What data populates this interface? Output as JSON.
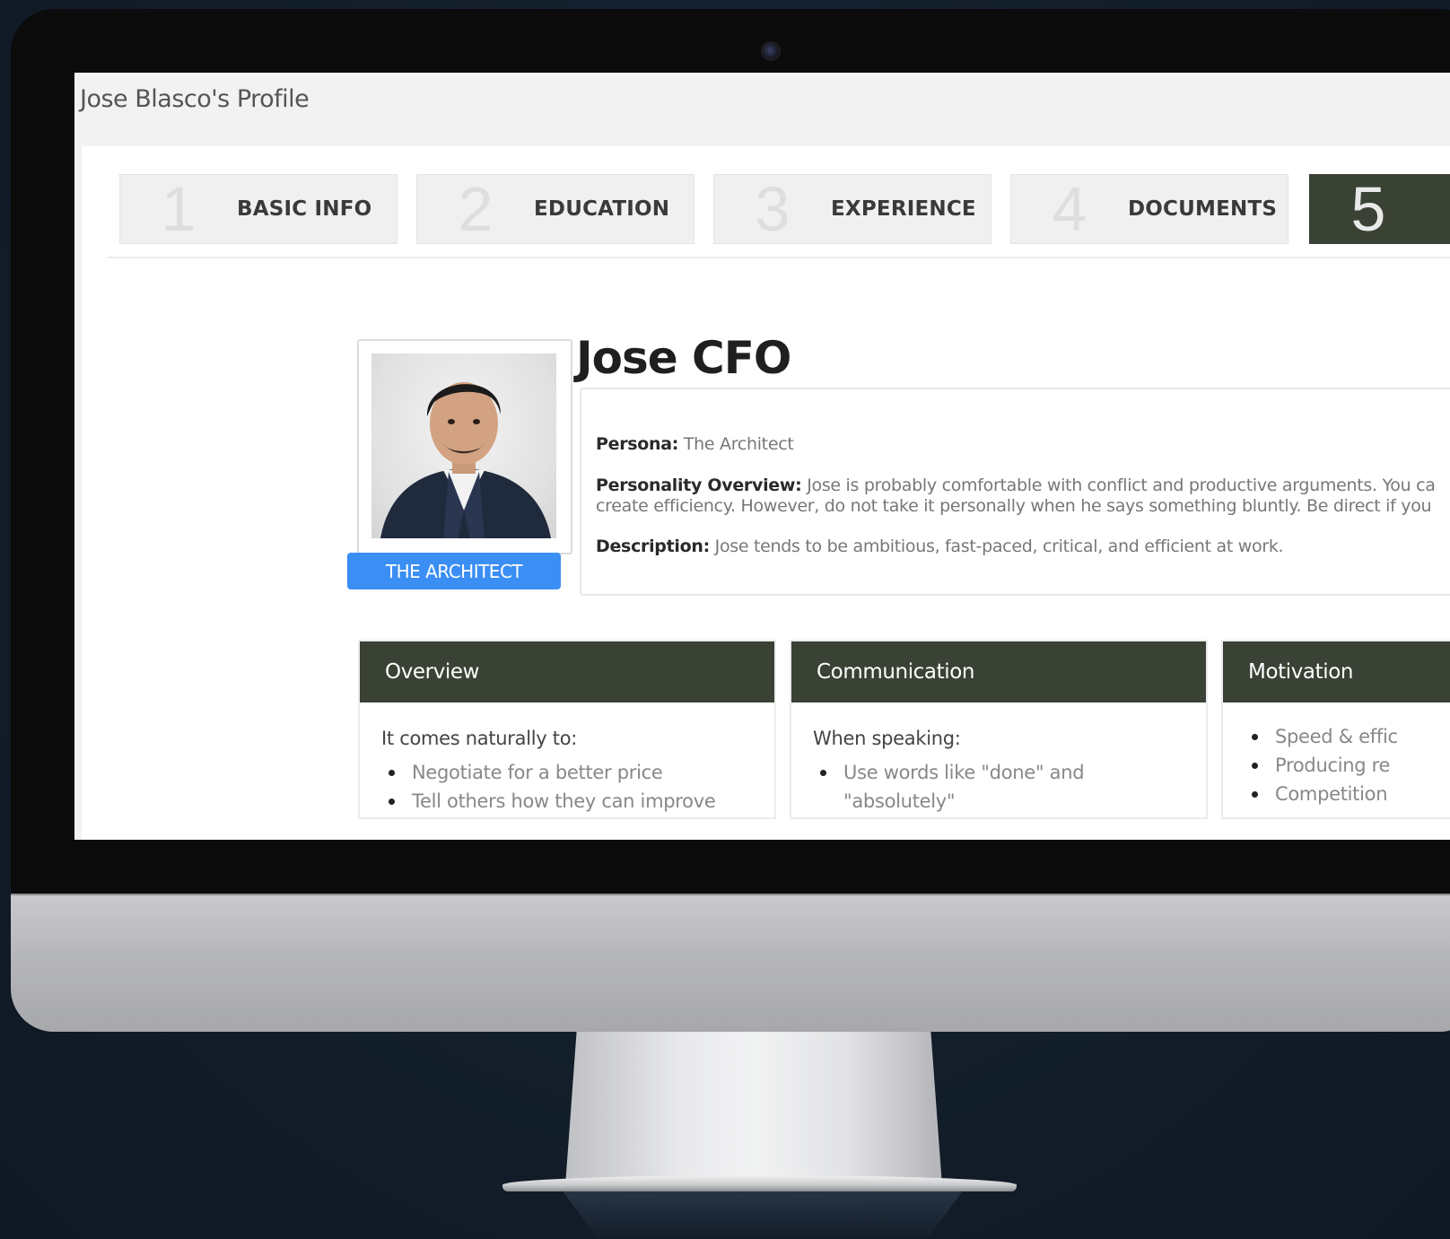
{
  "window": {
    "title": "Jose Blasco's Profile"
  },
  "steps": [
    {
      "number": "1",
      "label": "BASIC INFO",
      "active": false
    },
    {
      "number": "2",
      "label": "EDUCATION",
      "active": false
    },
    {
      "number": "3",
      "label": "EXPERIENCE",
      "active": false
    },
    {
      "number": "4",
      "label": "DOCUMENTS",
      "active": false
    },
    {
      "number": "5",
      "label": "",
      "active": true
    }
  ],
  "profile": {
    "name": "Jose CFO",
    "badge": "THE ARCHITECT",
    "persona_label": "Persona:",
    "persona_value": "The Architect",
    "personality_label": "Personality Overview:",
    "personality_line1": "Jose is probably comfortable with conflict and productive arguments. You ca",
    "personality_line2": "create efficiency. However, do not take it personally when he says something bluntly. Be direct if you",
    "description_label": "Description:",
    "description_value": "Jose tends to be ambitious, fast-paced, critical, and efficient at work."
  },
  "cards": {
    "overview": {
      "title": "Overview",
      "subtitle": "It comes naturally to:",
      "items": [
        "Negotiate for a better price",
        "Tell others how they can improve"
      ]
    },
    "communication": {
      "title": "Communication",
      "subtitle": "When speaking:",
      "items": [
        "Use words like \"done\" and",
        "\"absolutely\""
      ]
    },
    "motivation": {
      "title": "Motivation",
      "items": [
        "Speed & effic",
        "Producing re",
        "Competition"
      ]
    }
  },
  "colors": {
    "accent_dark": "#3a4135",
    "badge_blue": "#3a8ef4"
  }
}
